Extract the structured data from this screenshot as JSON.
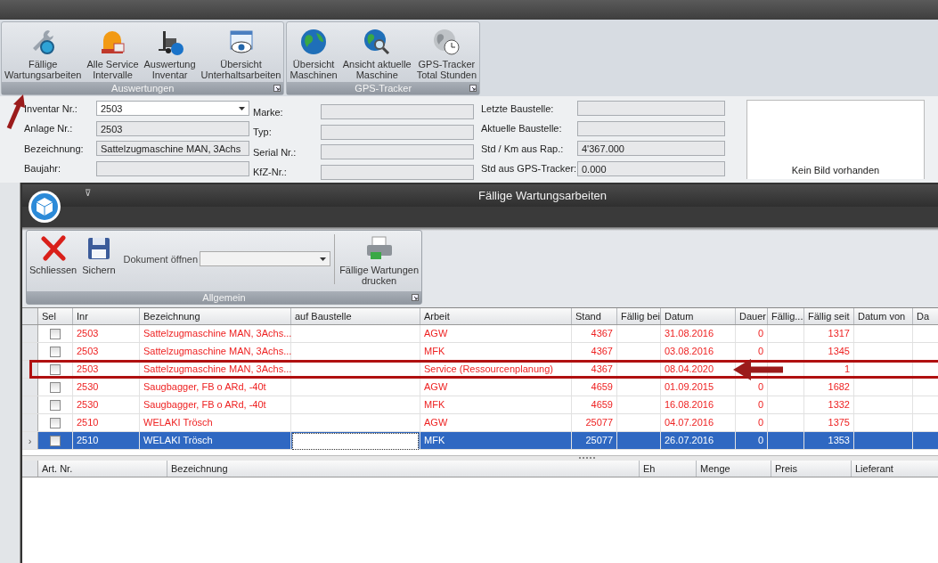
{
  "ribbon": {
    "groups": [
      {
        "label": "Auswertungen",
        "buttons": [
          {
            "lines": [
              "Fällige",
              "Wartungsarbeiten"
            ]
          },
          {
            "lines": [
              "Alle Service",
              "Intervalle"
            ]
          },
          {
            "lines": [
              "Auswertung",
              "Inventar"
            ]
          },
          {
            "lines": [
              "Übersicht",
              "Unterhaltsarbeiten"
            ]
          }
        ]
      },
      {
        "label": "GPS-Tracker",
        "buttons": [
          {
            "lines": [
              "Übersicht",
              "Maschinen"
            ]
          },
          {
            "lines": [
              "Ansicht aktuelle",
              "Maschine"
            ]
          },
          {
            "lines": [
              "GPS-Tracker",
              "Total Stunden"
            ]
          }
        ]
      }
    ]
  },
  "form": {
    "columns": [
      [
        {
          "label": "Inventar Nr.:",
          "value": "2503",
          "kind": "combo"
        },
        {
          "label": "Anlage Nr.:",
          "value": "2503",
          "kind": "readonly"
        },
        {
          "label": "Bezeichnung:",
          "value": "Sattelzugmaschine MAN, 3Achs",
          "kind": "readonly"
        },
        {
          "label": "Baujahr:",
          "kind": "readonly"
        }
      ],
      [
        {
          "label": "Marke:",
          "kind": "readonly"
        },
        {
          "label": "Typ:",
          "kind": "readonly"
        },
        {
          "label": "Serial Nr.:",
          "kind": "readonly"
        },
        {
          "label": "KfZ-Nr.:",
          "kind": "readonly"
        }
      ],
      [
        {
          "label": "Letzte Baustelle:",
          "kind": "readonly"
        },
        {
          "label": "Aktuelle Baustelle:",
          "kind": "readonly"
        },
        {
          "label": "Std / Km aus Rap.:",
          "value": "4'367.000",
          "kind": "readonly"
        },
        {
          "label": "Std aus GPS-Tracker:",
          "value": "0.000",
          "kind": "readonly"
        }
      ]
    ],
    "picture_placeholder": "Kein Bild vorhanden"
  },
  "dialog": {
    "title": "Fällige Wartungsarbeiten",
    "quick_access": "⊽",
    "ribbon_group": {
      "label": "Allgemein",
      "close": "Schliessen",
      "save": "Sichern",
      "document_label": "Dokument öffnen",
      "print": [
        "Fällige Wartungen",
        "drucken"
      ]
    },
    "grid": {
      "columns": [
        "Sel",
        "Inr",
        "Bezeichnung",
        "auf Baustelle",
        "Arbeit",
        "Stand",
        "Fällig bei",
        "Datum",
        "Dauer",
        "Fällig...",
        "Fällig seit",
        "Datum von",
        "Da"
      ],
      "rows": [
        {
          "checked": false,
          "selected": false,
          "marked": false,
          "inr": "2503",
          "bezeichnung": "Sattelzugmaschine MAN, 3Achs...",
          "arbeit": "AGW",
          "stand": "4367",
          "datum": "31.08.2016",
          "dauer": "0",
          "faellig_seit": "1317"
        },
        {
          "checked": false,
          "selected": false,
          "marked": false,
          "inr": "2503",
          "bezeichnung": "Sattelzugmaschine MAN, 3Achs...",
          "arbeit": "MFK",
          "stand": "4367",
          "datum": "03.08.2016",
          "dauer": "0",
          "faellig_seit": "1345"
        },
        {
          "checked": false,
          "selected": false,
          "marked": true,
          "inr": "2503",
          "bezeichnung": "Sattelzugmaschine MAN, 3Achs...",
          "arbeit": "Service (Ressourcenplanung)",
          "stand": "4367",
          "datum": "08.04.2020",
          "faellig_seit": "1"
        },
        {
          "checked": false,
          "selected": false,
          "marked": false,
          "inr": "2530",
          "bezeichnung": "Saugbagger, FB o ARd, -40t",
          "arbeit": "AGW",
          "stand": "4659",
          "datum": "01.09.2015",
          "dauer": "0",
          "faellig_seit": "1682"
        },
        {
          "checked": false,
          "selected": false,
          "marked": false,
          "inr": "2530",
          "bezeichnung": "Saugbagger, FB o ARd, -40t",
          "arbeit": "MFK",
          "stand": "4659",
          "datum": "16.08.2016",
          "dauer": "0",
          "faellig_seit": "1332"
        },
        {
          "checked": false,
          "selected": false,
          "marked": false,
          "inr": "2510",
          "bezeichnung": "WELAKI Trösch",
          "arbeit": "AGW",
          "stand": "25077",
          "datum": "04.07.2016",
          "dauer": "0",
          "faellig_seit": "1375"
        },
        {
          "checked": false,
          "selected": true,
          "marked": false,
          "indicator": "›",
          "inr": "2510",
          "bezeichnung": "WELAKI Trösch",
          "arbeit": "MFK",
          "stand": "25077",
          "datum": "26.07.2016",
          "dauer": "0",
          "faellig_seit": "1353"
        }
      ]
    },
    "parts_grid": {
      "columns": [
        "Art. Nr.",
        "Bezeichnung",
        "Eh",
        "Menge",
        "Preis",
        "Lieferant"
      ]
    }
  }
}
